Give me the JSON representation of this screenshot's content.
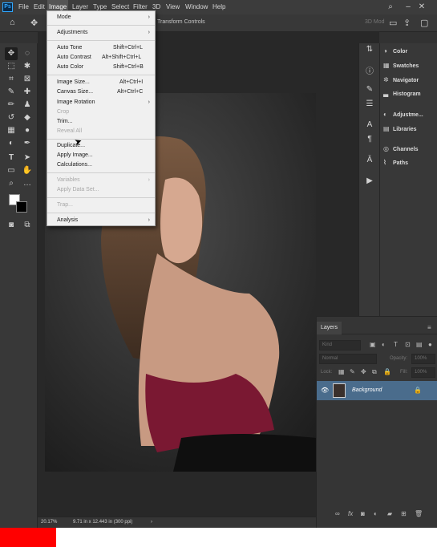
{
  "menubar": {
    "logo": "Ps",
    "items": [
      "File",
      "Edit",
      "Image",
      "Layer",
      "Type",
      "Select",
      "Filter",
      "3D",
      "View",
      "Window",
      "Help"
    ],
    "search": "⌕",
    "share": "⇪"
  },
  "options": {
    "transform_label": "Transform Controls",
    "mode_label": "3D Mod"
  },
  "dropdown": {
    "items": [
      {
        "label": "Mode",
        "submenu": "›"
      },
      {
        "label": "Adjustments",
        "submenu": "›"
      },
      {
        "label": "Auto Tone",
        "shortcut": "Shift+Ctrl+L"
      },
      {
        "label": "Auto Contrast",
        "shortcut": "Alt+Shift+Ctrl+L"
      },
      {
        "label": "Auto Color",
        "shortcut": "Shift+Ctrl+B"
      },
      {
        "label": "Image Size...",
        "shortcut": "Alt+Ctrl+I"
      },
      {
        "label": "Canvas Size...",
        "shortcut": "Alt+Ctrl+C"
      },
      {
        "label": "Image Rotation",
        "submenu": "›"
      },
      {
        "label": "Crop"
      },
      {
        "label": "Trim..."
      },
      {
        "label": "Reveal All"
      },
      {
        "label": "Duplicate..."
      },
      {
        "label": "Apply Image..."
      },
      {
        "label": "Calculations..."
      },
      {
        "label": "Variables",
        "submenu": "›"
      },
      {
        "label": "Apply Data Set..."
      },
      {
        "label": "Trap..."
      },
      {
        "label": "Analysis",
        "submenu": "›"
      }
    ]
  },
  "panels": {
    "list": [
      "Color",
      "Swatches",
      "Navigator",
      "Histogram",
      "Adjustme...",
      "Libraries",
      "Channels",
      "Paths"
    ]
  },
  "layers": {
    "tab": "Layers",
    "kind_placeholder": "Kind",
    "blend_mode": "Normal",
    "opacity_label": "Opacity:",
    "opacity_value": "100%",
    "lock_label": "Lock:",
    "fill_label": "Fill:",
    "fill_value": "100%",
    "layer_name": "Background"
  },
  "status": {
    "zoom": "20.17%",
    "doc_info": "9.71 in x 12.443 in (300 ppi)",
    "arrow": "›"
  },
  "colors": {
    "accent": "#31a8ff",
    "selected_layer": "#4a6c8c",
    "red_block": "#ff0000"
  }
}
